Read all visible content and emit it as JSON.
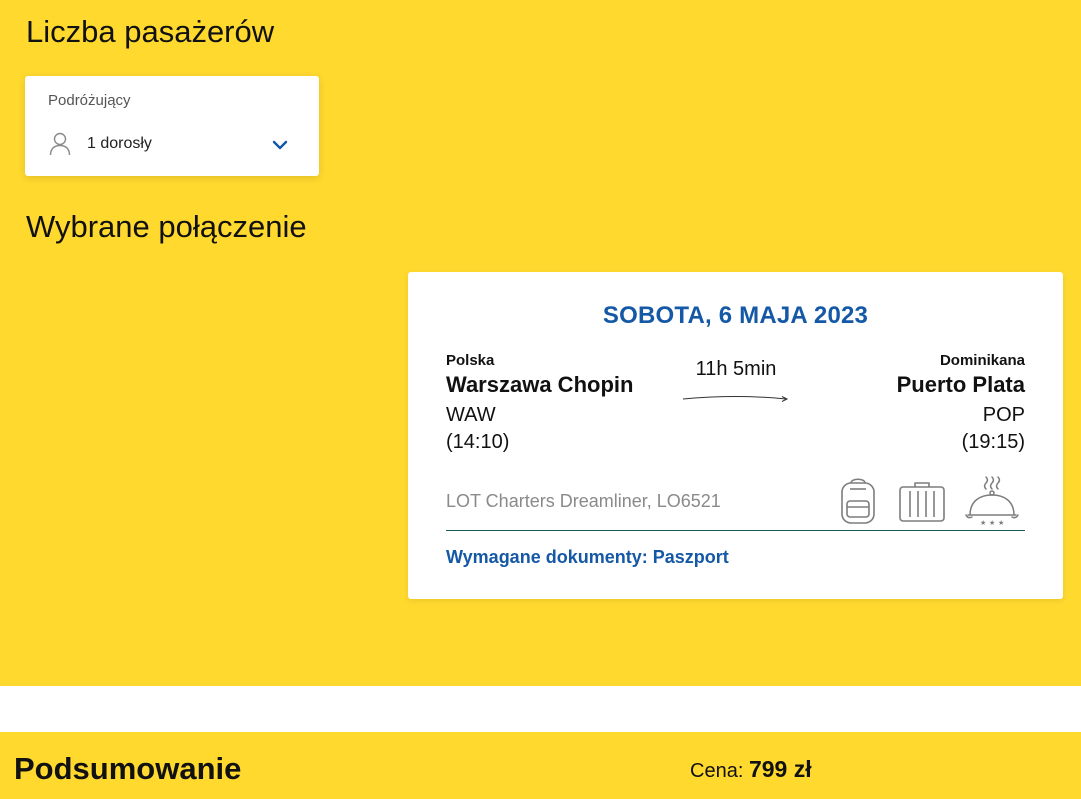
{
  "passengers": {
    "heading": "Liczba pasażerów",
    "field_label": "Podróżujący",
    "selected_value": "1 dorosły",
    "person_icon": "person-icon",
    "dropdown_icon": "chevron-down-icon"
  },
  "selected": {
    "heading": "Wybrane połączenie",
    "date": "SOBOTA, 6 MAJA 2023",
    "origin": {
      "country": "Polska",
      "city": "Warszawa Chopin",
      "code": "WAW",
      "time": "(14:10)"
    },
    "destination": {
      "country": "Dominikana",
      "city": "Puerto Plata",
      "code": "POP",
      "time": "(19:15)"
    },
    "duration": "11h 5min",
    "aircraft": "LOT Charters Dreamliner, LO6521",
    "amenity_icons": [
      "backpack-icon",
      "suitcase-icon",
      "meal-cloche-icon"
    ],
    "documents": "Wymagane dokumenty: Paszport"
  },
  "summary": {
    "heading": "Podsumowanie",
    "price_label": "Cena:",
    "price_value": "799 zł"
  },
  "colors": {
    "background_yellow": "#ffd92e",
    "accent_blue": "#1458a6",
    "divider_teal": "#1a5c5c"
  }
}
